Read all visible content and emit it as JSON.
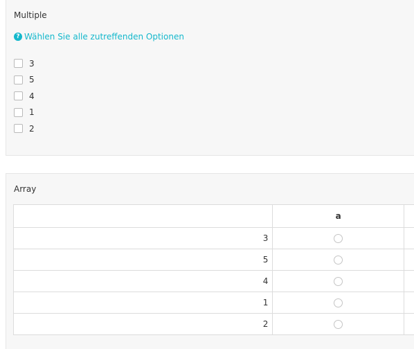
{
  "multiple": {
    "title": "Multiple",
    "help_text": "Wählen Sie alle zutreffenden Optionen",
    "help_icon": "question-circle-icon",
    "options": [
      {
        "label": "3",
        "checked": false
      },
      {
        "label": "5",
        "checked": false
      },
      {
        "label": "4",
        "checked": false
      },
      {
        "label": "1",
        "checked": false
      },
      {
        "label": "2",
        "checked": false
      }
    ]
  },
  "array": {
    "title": "Array",
    "columns": [
      "",
      "a",
      ""
    ],
    "rows": [
      {
        "label": "3",
        "selected": false
      },
      {
        "label": "5",
        "selected": false
      },
      {
        "label": "4",
        "selected": false
      },
      {
        "label": "1",
        "selected": false
      },
      {
        "label": "2",
        "selected": false
      }
    ]
  },
  "colors": {
    "accent": "#14b8cc",
    "card_background": "#f7f7f7",
    "border": "#dcdcdc"
  }
}
